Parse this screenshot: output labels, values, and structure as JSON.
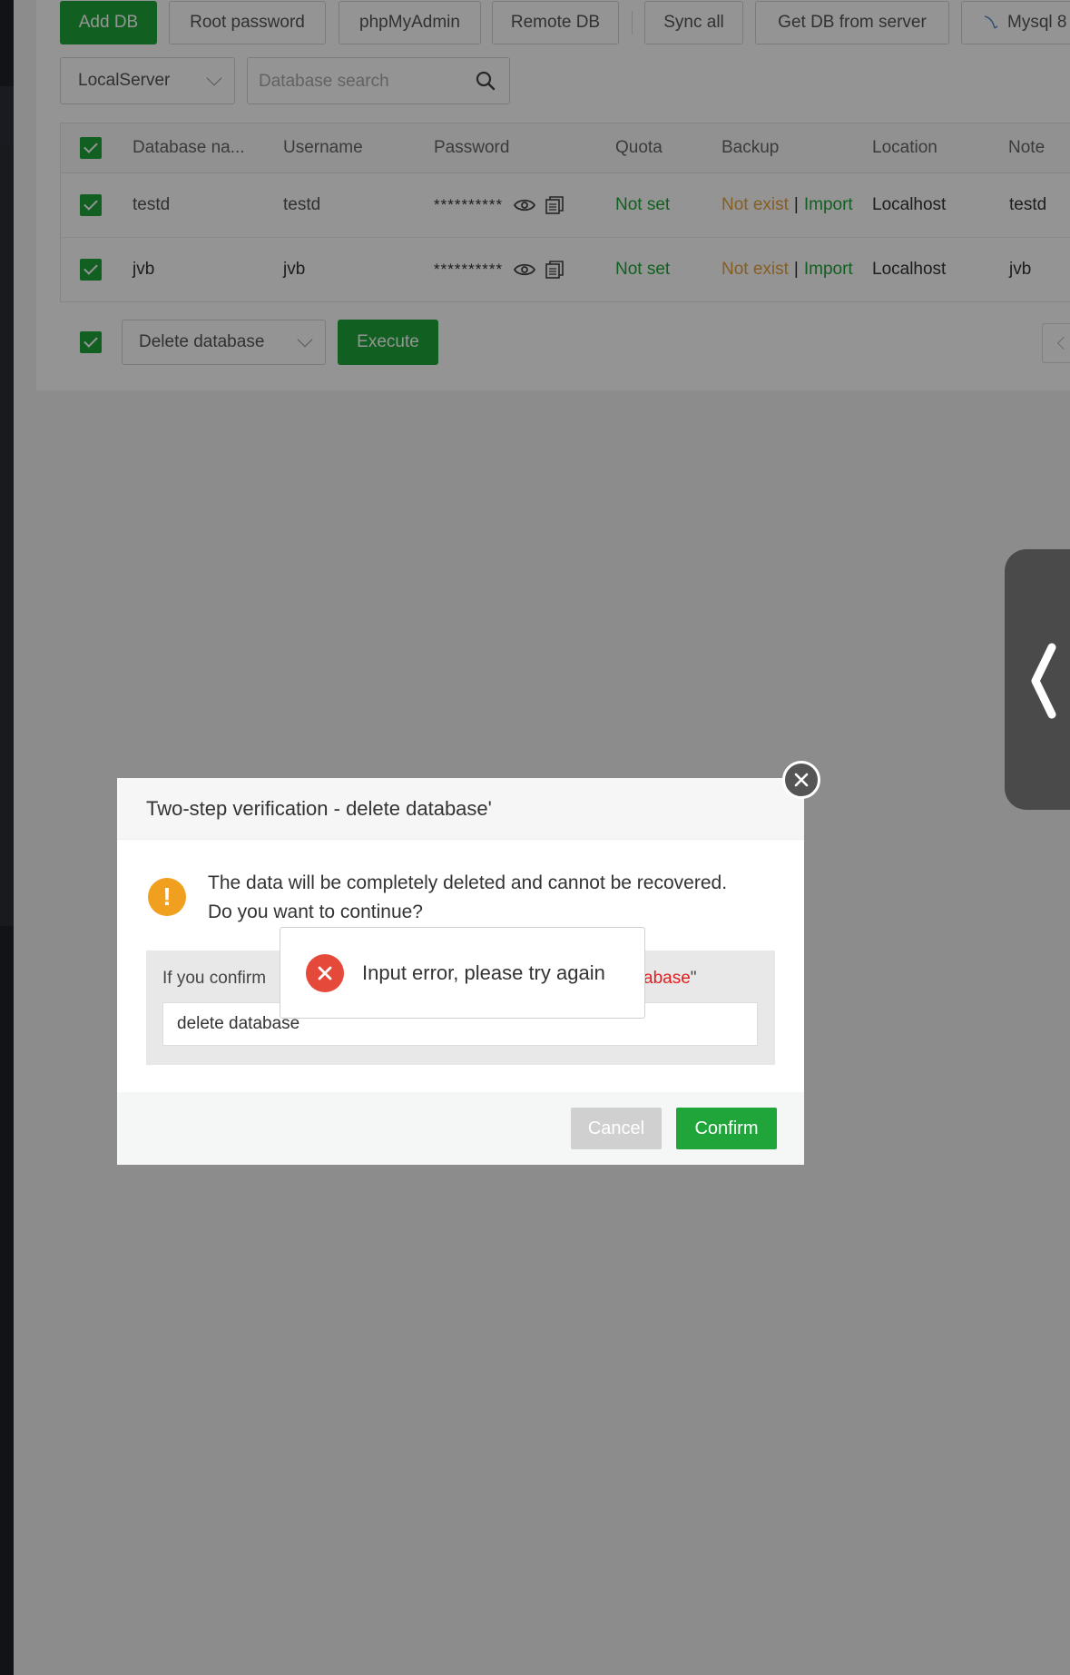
{
  "toolbar": {
    "add_db": "Add DB",
    "root_password": "Root password",
    "phpmyadmin": "phpMyAdmin",
    "remote_db": "Remote DB",
    "sync_all": "Sync all",
    "get_db_from_server": "Get DB from server",
    "mysql": "Mysql 8"
  },
  "filters": {
    "server_select": "LocalServer",
    "search_placeholder": "Database search"
  },
  "table": {
    "headers": [
      "Database na...",
      "Username",
      "Password",
      "Quota",
      "Backup",
      "Location",
      "Note"
    ],
    "rows": [
      {
        "database": "testd",
        "username": "testd",
        "password": "**********",
        "quota": "Not set",
        "backup_status": "Not exist",
        "backup_sep": "|",
        "backup_action": "Import",
        "location": "Localhost",
        "note": "testd"
      },
      {
        "database": "jvb",
        "username": "jvb",
        "password": "**********",
        "quota": "Not set",
        "backup_status": "Not exist",
        "backup_sep": "|",
        "backup_action": "Import",
        "location": "Localhost",
        "note": "jvb"
      }
    ]
  },
  "bulk": {
    "action_select": "Delete database",
    "execute": "Execute"
  },
  "dialog": {
    "title": "Two-step verification - delete database'",
    "message_line1": "The data will be completely deleted and cannot be recovered.",
    "message_line2": "Do you want to continue?",
    "confirm_label_prefix": "If you confirm",
    "confirm_label_highlight": "abase",
    "confirm_label_suffix": "\"",
    "input_value": "delete database",
    "cancel": "Cancel",
    "confirm": "Confirm"
  },
  "toast": {
    "message": "Input error, please try again"
  },
  "colors": {
    "accent": "#20a53a",
    "warning": "#f0a01e",
    "error": "#e5493a",
    "danger_text": "#e02020"
  }
}
